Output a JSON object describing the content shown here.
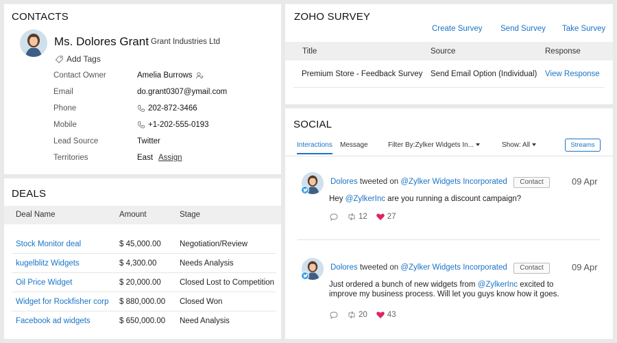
{
  "contacts": {
    "title": "CONTACTS",
    "name": "Ms. Dolores Grant",
    "company": "- Grant Industries Ltd",
    "add_tags": "Add Tags",
    "fields": [
      {
        "label": "Contact Owner",
        "value": "Amelia Burrows"
      },
      {
        "label": "Email",
        "value": "do.grant0307@ymail.com"
      },
      {
        "label": "Phone",
        "value": "202-872-3466"
      },
      {
        "label": "Mobile",
        "value": "+1-202-555-0193"
      },
      {
        "label": "Lead Source",
        "value": "Twitter"
      },
      {
        "label": "Territories",
        "value": "East",
        "link": "Assign"
      }
    ]
  },
  "deals": {
    "title": "DEALS",
    "columns": [
      "Deal Name",
      "Amount",
      "Stage"
    ],
    "rows": [
      {
        "name": "Stock Monitor deal",
        "amount": "$ 45,000.00",
        "stage": "Negotiation/Review"
      },
      {
        "name": "kugelblitz Widgets",
        "amount": "$ 4,300.00",
        "stage": "Needs Analysis"
      },
      {
        "name": "Oil Price Widget",
        "amount": "$ 20,000.00",
        "stage": "Closed Lost to Competition"
      },
      {
        "name": "Widget for Rockfisher corp",
        "amount": "$ 880,000.00",
        "stage": "Closed Won"
      },
      {
        "name": "Facebook ad widgets",
        "amount": "$ 650,000.00",
        "stage": "Need Analysis"
      }
    ]
  },
  "survey": {
    "title": "ZOHO SURVEY",
    "actions": [
      "Create Survey",
      "Send Survey",
      "Take Survey"
    ],
    "columns": [
      "Title",
      "Source",
      "Response"
    ],
    "row": {
      "title": "Premium Store - Feedback Survey",
      "source": "Send Email Option (Individual)",
      "response": "View Response"
    }
  },
  "social": {
    "title": "SOCIAL",
    "tabs": [
      "Interactions",
      "Message"
    ],
    "filter_label": "Filter By:Zylker Widgets In...",
    "show_label": "Show:",
    "show_value": "All",
    "streams_label": "Streams",
    "posts": [
      {
        "author": "Dolores",
        "verb": "tweeted on",
        "target": "@Zylker Widgets Incorporated",
        "contact_label": "Contact",
        "date": "09 Apr",
        "text_pre": "Hey ",
        "mention": "@ZylkerInc",
        "text_post": " are you running a discount campaign?",
        "retweets": "12",
        "likes": "27"
      },
      {
        "author": "Dolores",
        "verb": "tweeted on",
        "target": "@Zylker Widgets Incorporated",
        "contact_label": "Contact",
        "date": "09 Apr",
        "text_pre": "Just ordered a bunch of new widgets from ",
        "mention": "@ZylkerInc",
        "text_post": " excited to improve my business process. Will let you guys know how it goes.",
        "retweets": "20",
        "likes": "43"
      }
    ]
  },
  "colors": {
    "accent": "#1a73c6",
    "heart": "#e0245e",
    "twitter": "#3aa0e6"
  }
}
